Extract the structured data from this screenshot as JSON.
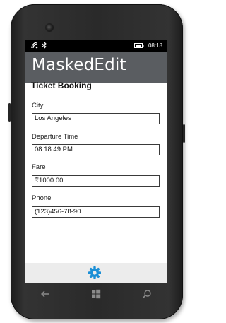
{
  "status": {
    "time": "08:18"
  },
  "app": {
    "title": "MaskedEdit"
  },
  "page": {
    "title": "Ticket Booking"
  },
  "form": {
    "fields": [
      {
        "label": "City",
        "value": "Los Angeles"
      },
      {
        "label": "Departure Time",
        "value": "08:18:49 PM"
      },
      {
        "label": "Fare",
        "value": "₹1000.00"
      },
      {
        "label": "Phone",
        "value": "(123)456-78-90"
      }
    ]
  },
  "icons": {
    "settings": "gear-icon",
    "back": "back-arrow-icon",
    "start": "windows-logo-icon",
    "search": "search-icon"
  },
  "colors": {
    "accent": "#1a8fd6",
    "title_bar": "#5a5d61",
    "device": "#2a2a2a"
  }
}
